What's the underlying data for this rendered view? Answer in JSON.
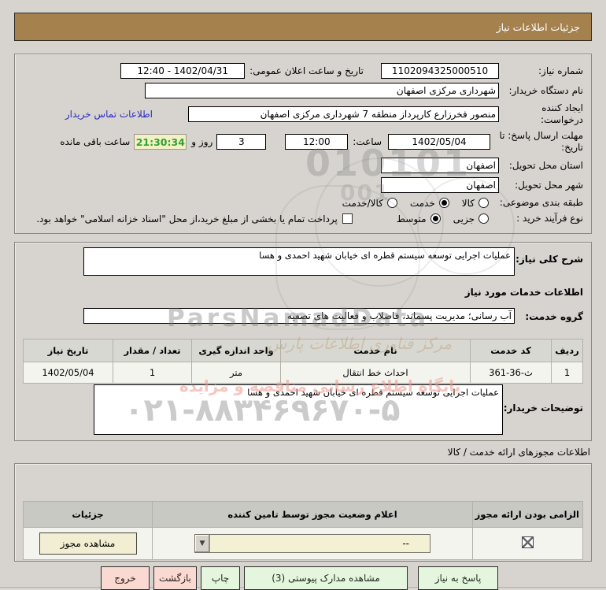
{
  "colors": {
    "page_bg": "#d7d4cf",
    "title_bar_bg": "#a5814e",
    "link_blue": "#2a2ac4",
    "countdown_green": "#2fa32f",
    "countdown_bg": "#f3f0c6",
    "select_bg": "#f4f0d3",
    "button_green_bg": "#e4f6de",
    "button_pink_bg": "#f9d9d2"
  },
  "title_bar": {
    "label": "جزئیات اطلاعات نیاز"
  },
  "box1": {
    "need_number_label": "شماره نیاز:",
    "need_number_value": "1102094325000510",
    "announce_label": "تاریخ و ساعت اعلان عمومی:",
    "announce_value": "1402/04/31 - 12:40",
    "buyer_label": "نام دستگاه خریدار:",
    "buyer_value": "شهرداری مرکزی اصفهان",
    "creator_label": "ایجاد کننده درخواست:",
    "creator_value": "منصور فخرزارع کارپرداز منطقه 7 شهرداری مرکزی اصفهان",
    "contact_link": "اطلاعات تماس خریدار",
    "deadline_label": "مهلت ارسال پاسخ: تا تاریخ:",
    "deadline_date": "1402/05/04",
    "hour_label": "ساعت:",
    "hour_value": "12:00",
    "days_value": "3",
    "days_label": "روز و",
    "countdown_value": "21:30:34",
    "countdown_label": "ساعت باقی مانده",
    "province_label": "استان محل تحویل:",
    "province_value": "اصفهان",
    "city_label": "شهر محل تحویل:",
    "city_value": "اصفهان",
    "category_label": "طبقه بندی موضوعی:",
    "category_options": [
      "کالا",
      "خدمت",
      "کالا/خدمت"
    ],
    "category_selected": "خدمت",
    "process_label": "نوع فرآیند خرید :",
    "process_options": [
      "جزیی",
      "متوسط"
    ],
    "process_selected": "متوسط",
    "treasury_checkbox_label": "پرداخت تمام یا بخشی از مبلغ خرید،از محل \"اسناد خزانه اسلامی\" خواهد بود."
  },
  "box2": {
    "desc_label": "شرح کلی نیاز:",
    "desc_value": "عملیات اجرایی توسعه سیستم قطره ای خیابان شهید احمدی و هسا",
    "section_title": "اطلاعات خدمات مورد نیاز",
    "group_label": "گروه خدمت:",
    "group_value": "آب رسانی؛ مدیریت پسماند، فاضلاب و فعالیت های تصفیه",
    "table": {
      "headers": [
        "ردیف",
        "کد خدمت",
        "نام خدمت",
        "واحد اندازه گیری",
        "تعداد / مقدار",
        "تاریخ نیاز"
      ],
      "rows": [
        [
          "1",
          "ث-36-361",
          "احداث خط انتقال",
          "متر",
          "1",
          "1402/05/04"
        ]
      ]
    },
    "notes_label": "توضیحات خریدار:",
    "notes_value": "عملیات اجرایی توسعه سیستم قطره ای خیابان شهید احمدی و هسا"
  },
  "permits": {
    "section_title": "اطلاعات مجوزهای ارائه خدمت / کالا",
    "headers": [
      "الزامی بودن ارائه مجوز",
      "اعلام وضعیت مجوز توسط تامین کننده",
      "جزئیات"
    ],
    "required_checked": true,
    "status_value": "--",
    "details_button": "مشاهده مجوز"
  },
  "footer_buttons": [
    {
      "label": "پاسخ به نیاز",
      "style": "green"
    },
    {
      "label": "مشاهده مدارک پیوستی (3)",
      "style": "green"
    },
    {
      "label": "چاپ",
      "style": "green"
    },
    {
      "label": "بازگشت",
      "style": "pink"
    },
    {
      "label": "خروج",
      "style": "pink"
    }
  ],
  "watermark": {
    "digits": "010101",
    "digits2": "001",
    "brand": "ParsNamadData",
    "pink_line": "پایگاه اطلاع رسانی مناقصه و مزایده",
    "phone": "۰۲۱-۸۸۳۴۶۹۶۷۰-۵",
    "calligraphy": "مرکز فناوری اطلاعات پارس"
  }
}
